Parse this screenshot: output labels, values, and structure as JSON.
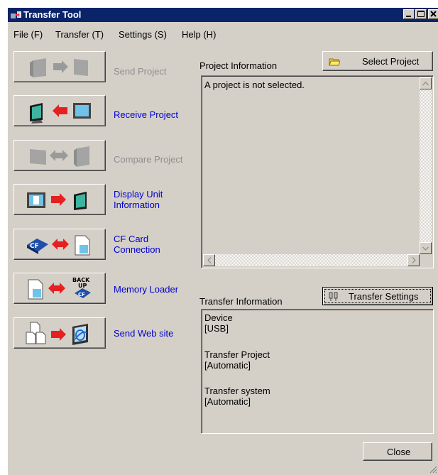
{
  "window": {
    "title": "Transfer Tool",
    "title_icon": "transfer-tool-icon",
    "controls": [
      "minimize-icon",
      "maximize-icon",
      "close-icon"
    ]
  },
  "menu": {
    "file": "File (F)",
    "transfer": "Transfer (T)",
    "settings": "Settings (S)",
    "help": "Help (H)"
  },
  "actions": [
    {
      "label": "Send Project",
      "enabled": false,
      "icon": "send-project-icon"
    },
    {
      "label": "Receive Project",
      "enabled": true,
      "icon": "receive-project-icon"
    },
    {
      "label": "Compare Project",
      "enabled": false,
      "icon": "compare-project-icon"
    },
    {
      "label_line1": "Display Unit",
      "label_line2": "Information",
      "enabled": true,
      "icon": "display-unit-info-icon"
    },
    {
      "label_line1": "CF Card",
      "label_line2": "Connection",
      "enabled": true,
      "icon": "cf-card-connection-icon"
    },
    {
      "label": "Memory Loader",
      "enabled": true,
      "icon": "memory-loader-icon",
      "icon_text_top": "BACK",
      "icon_text_mid": "UP",
      "icon_text_bot": "CF"
    },
    {
      "label": "Send Web site",
      "enabled": true,
      "icon": "send-web-site-icon"
    }
  ],
  "project_info": {
    "label": "Project Information",
    "select_button": "Select Project",
    "content": "A project is not selected."
  },
  "transfer_info": {
    "label": "Transfer Information",
    "settings_button": "Transfer Settings",
    "device_label": "Device",
    "device_value": "[USB]",
    "project_label": "Transfer Project",
    "project_value": "[Automatic]",
    "system_label": "Transfer system",
    "system_value": "[Automatic]"
  },
  "close_button": "Close",
  "colors": {
    "face": "#d4d0c8",
    "titlebar": "#0a246a",
    "link_text": "#0000cc",
    "disabled_text": "#8e8e8e",
    "arrow_red": "#e62020"
  }
}
